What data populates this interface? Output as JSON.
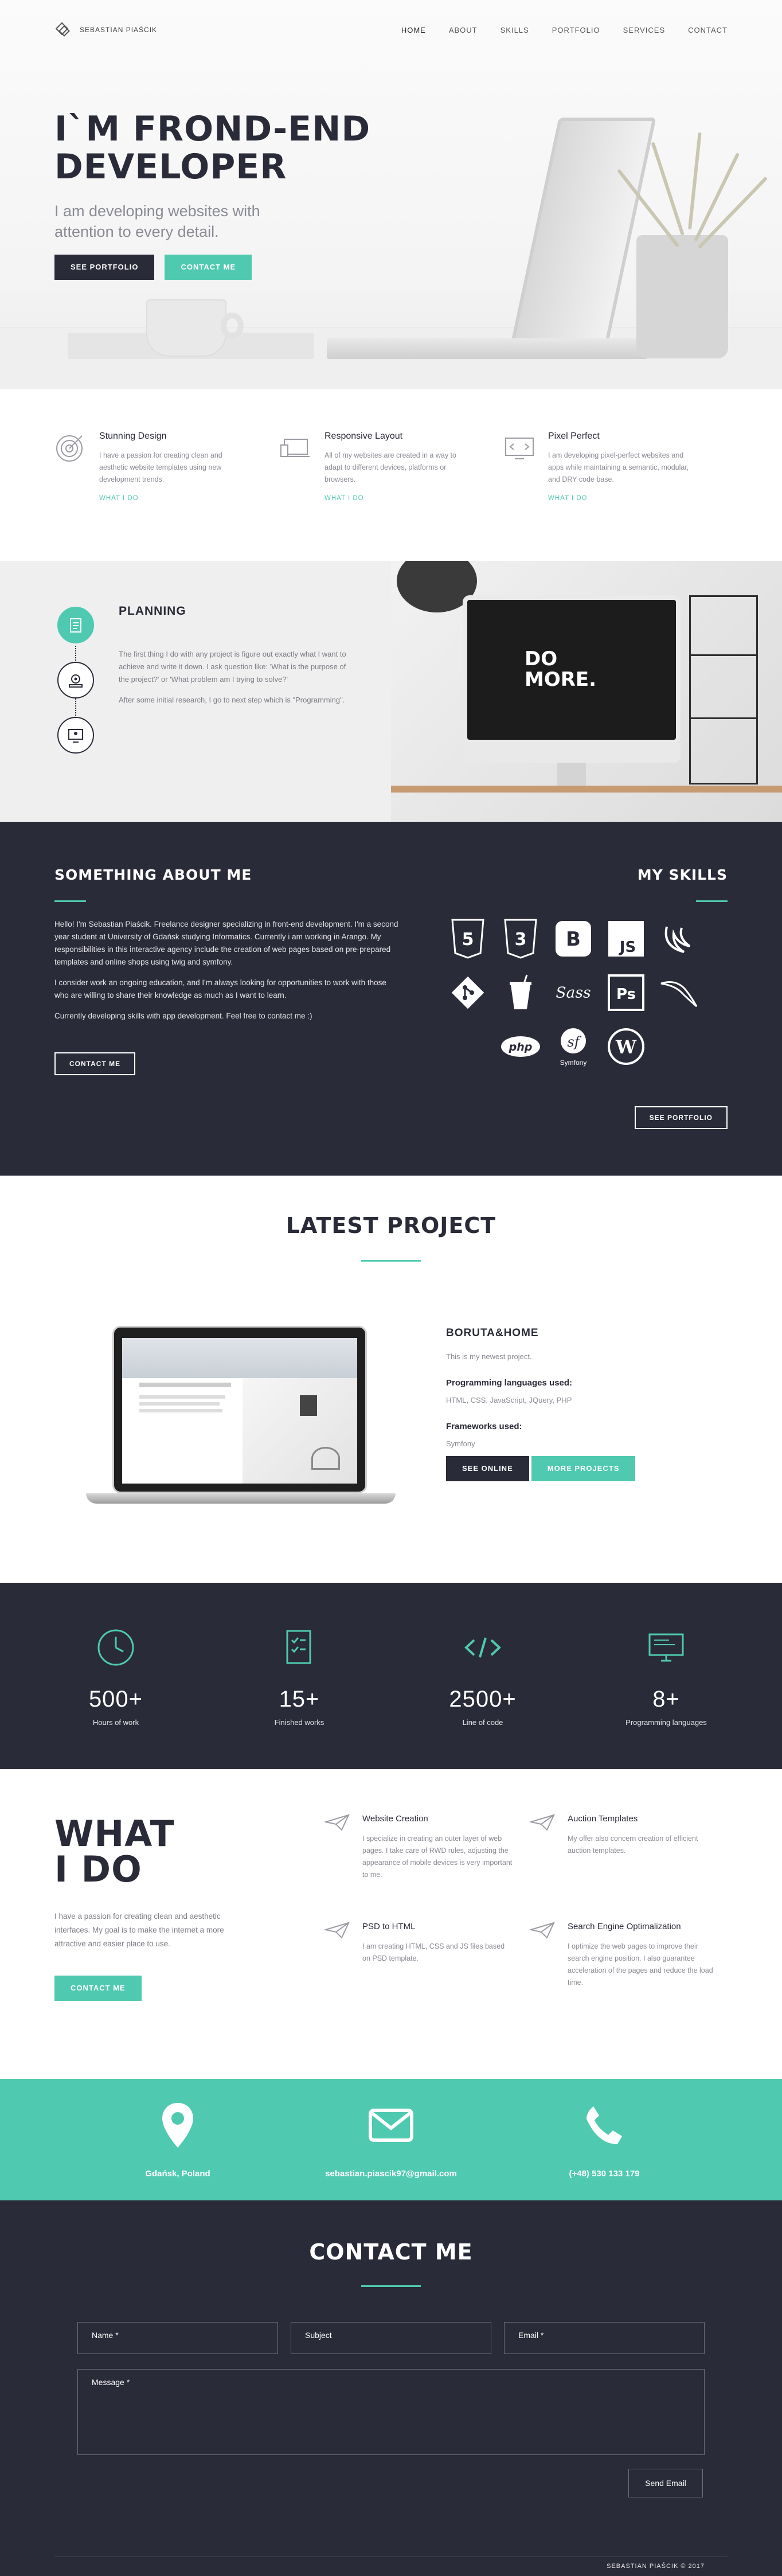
{
  "nav": {
    "brand": "SEBASTIAN PIAŚCIK",
    "items": [
      {
        "label": "HOME",
        "active": true
      },
      {
        "label": "ABOUT"
      },
      {
        "label": "SKILLS"
      },
      {
        "label": "PORTFOLIO"
      },
      {
        "label": "SERVICES"
      },
      {
        "label": "CONTACT"
      }
    ]
  },
  "hero": {
    "title_line1": "I`M FROND-END",
    "title_line2": "DEVELOPER",
    "subtitle": "I am developing websites with attention to every detail.",
    "btn_portfolio": "SEE PORTFOLIO",
    "btn_contact": "CONTACT ME"
  },
  "features": [
    {
      "title": "Stunning Design",
      "text": "I have a passion for creating clean and aesthetic website templates using new development trends.",
      "link": "WHAT I DO",
      "icon": "target-icon"
    },
    {
      "title": "Responsive Layout",
      "text": "All of my websites are created in a way to adapt to different devices, platforms or browsers.",
      "link": "WHAT I DO",
      "icon": "devices-icon"
    },
    {
      "title": "Pixel Perfect",
      "text": "I am developing pixel-perfect websites and apps while maintaining a semantic, modular, and DRY code base.",
      "link": "WHAT I DO",
      "icon": "monitor-code-icon"
    }
  ],
  "planning": {
    "title": "PLANNING",
    "p1": "The first thing I do with any project is figure out exactly what I want to achieve and write it down. I ask question like: 'What is the purpose of the project?' or 'What problem am I trying to solve?'",
    "p2": "After some initial research, I go to next step which is \"Programming\".",
    "imac_line1": "DO",
    "imac_line2": "MORE."
  },
  "about": {
    "title": "SOMETHING ABOUT ME",
    "p1": "Hello! I'm Sebastian Piaścik. Freelance designer specializing in front-end development. I'm a second year student at University of Gdańsk studying Informatics. Currently i am working in Arango. My responsibilities in this interactive agency include the creation of web pages based on pre-prepared templates and online shops using twig and symfony.",
    "p2": "I consider work an ongoing education, and I'm always looking for opportunities to work with those who are willing to share their knowledge as much as I want to learn.",
    "p3": "Currently developing skills with app development. Feel free to contact me :)",
    "contact_btn": "CONTACT ME",
    "skills_title": "MY SKILLS",
    "portfolio_btn": "SEE PORTFOLIO",
    "skills": [
      {
        "icon": "html5-icon",
        "text": "5"
      },
      {
        "icon": "css3-icon",
        "text": "3"
      },
      {
        "icon": "bootstrap-icon",
        "text": "B"
      },
      {
        "icon": "javascript-icon",
        "text": "JS"
      },
      {
        "icon": "jquery-icon",
        "text": ""
      },
      {
        "icon": "git-icon",
        "text": ""
      },
      {
        "icon": "gulp-icon",
        "text": ""
      },
      {
        "icon": "sass-icon",
        "text": "Sass"
      },
      {
        "icon": "photoshop-icon",
        "text": "Ps"
      },
      {
        "icon": "mysql-icon",
        "text": ""
      },
      {
        "icon": "php-icon",
        "text": "php"
      },
      {
        "icon": "symfony-icon",
        "text": "Symfony"
      },
      {
        "icon": "wordpress-icon",
        "text": "W"
      }
    ]
  },
  "latest": {
    "title": "LATEST PROJECT",
    "project_name": "BORUTA&HOME",
    "description": "This is my newest project.",
    "languages_label": "Programming languages used:",
    "languages": "HTML, CSS, JavaScript, JQuery, PHP",
    "frameworks_label": "Frameworks used:",
    "frameworks": "Symfony",
    "btn_online": "SEE ONLINE",
    "btn_more": "MORE PROJECTS"
  },
  "stats": [
    {
      "num": "500+",
      "label": "Hours of work",
      "icon": "clock-icon"
    },
    {
      "num": "15+",
      "label": "Finished works",
      "icon": "checklist-icon"
    },
    {
      "num": "2500+",
      "label": "Line of code",
      "icon": "code-icon"
    },
    {
      "num": "8+",
      "label": "Programming languages",
      "icon": "monitor-icon"
    }
  ],
  "whatido": {
    "title_line1": "WHAT",
    "title_line2": "I DO",
    "text": "I have a passion for creating clean and aesthetic interfaces. My goal is to make the internet a more attractive and easier place to use.",
    "btn": "CONTACT ME",
    "services": [
      {
        "title": "Website Creation",
        "text": "I specialize in creating an outer layer of web pages. I take care of RWD rules, adjusting the appearance of mobile devices is very important to me."
      },
      {
        "title": "Auction Templates",
        "text": "My offer also concern creation of efficient auction templates."
      },
      {
        "title": "PSD to HTML",
        "text": "I am creating HTML, CSS and JS files based on PSD template."
      },
      {
        "title": "Search Engine Optimalization",
        "text": "I optimize the web pages to improve their search engine position. I also guarantee acceleration of the pages and reduce the load time."
      }
    ]
  },
  "strip": {
    "location": "Gdańsk, Poland",
    "email": "sebastian.piascik97@gmail.com",
    "phone": "(+48) 530 133 179"
  },
  "contact": {
    "title": "CONTACT ME",
    "name_ph": "Name *",
    "subject_ph": "Subject",
    "email_ph": "Email *",
    "message_ph": "Message *",
    "send": "Send Email",
    "copyright": "SEBASTIAN PIAŚCIK © 2017"
  },
  "colors": {
    "accent": "#4fcab0",
    "dark": "#2a2b38"
  }
}
